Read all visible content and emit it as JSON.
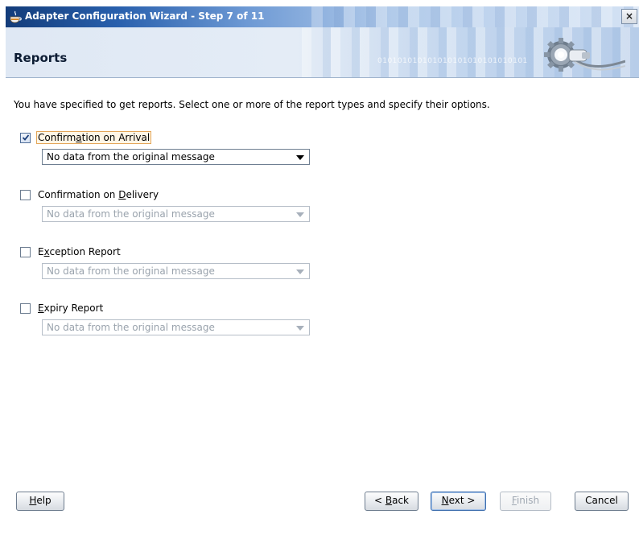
{
  "window": {
    "title": "Adapter Configuration Wizard - Step 7 of 11",
    "close_glyph": "×"
  },
  "header": {
    "title": "Reports",
    "decoration_text": "010101010101010101010101010101"
  },
  "instruction": "You have specified to get reports.  Select one or more of the report types and specify their options.",
  "reports": [
    {
      "label_pre": "Confirm",
      "mnemonic": "a",
      "label_post": "tion on Arrival",
      "checked": true,
      "option": "No data from the original message",
      "enabled": true
    },
    {
      "label_pre": "Confirmation on ",
      "mnemonic": "D",
      "label_post": "elivery",
      "checked": false,
      "option": "No data from the original message",
      "enabled": false
    },
    {
      "label_pre": "E",
      "mnemonic": "x",
      "label_post": "ception Report",
      "checked": false,
      "option": "No data from the original message",
      "enabled": false
    },
    {
      "label_pre": "",
      "mnemonic": "E",
      "label_post": "xpiry Report",
      "checked": false,
      "option": "No data from the original message",
      "enabled": false
    }
  ],
  "buttons": {
    "help": {
      "pre": "",
      "mnemonic": "H",
      "post": "elp"
    },
    "back": {
      "pre": "< ",
      "mnemonic": "B",
      "post": "ack"
    },
    "next": {
      "pre": "",
      "mnemonic": "N",
      "post": "ext >"
    },
    "finish": {
      "pre": "",
      "mnemonic": "F",
      "post": "inish"
    },
    "cancel": {
      "pre": "Cancel",
      "mnemonic": "",
      "post": ""
    }
  },
  "icons": {
    "app": "java-cup-icon",
    "header": "gear-cable-icon",
    "check": "checkmark-icon"
  }
}
